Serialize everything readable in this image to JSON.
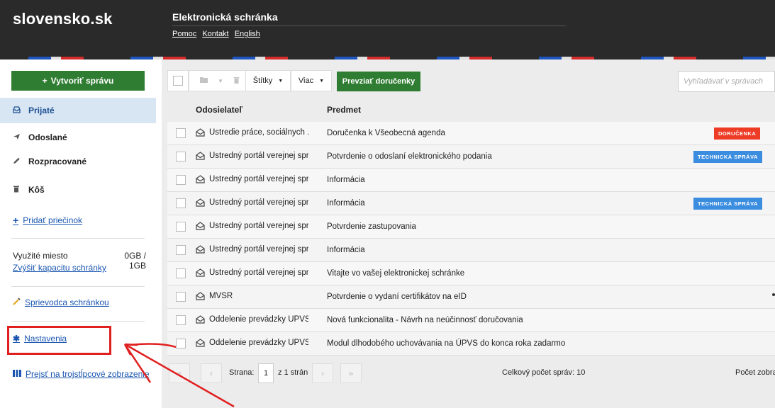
{
  "header": {
    "logo": "slovensko.sk",
    "app_title": "Elektronická schránka",
    "links": [
      "Pomoc",
      "Kontakt",
      "English"
    ]
  },
  "sidebar": {
    "create_button": "Vytvoriť správu",
    "nav": [
      "Prijaté",
      "Odoslané",
      "Rozpracované",
      "Kôš"
    ],
    "add_folder": "Pridať priečinok",
    "storage_label": "Využité miesto",
    "storage_value": "0GB / 1GB",
    "increase_capacity": "Zvýšiť kapacitu schránky",
    "guide": "Sprievodca schránkou",
    "settings": "Nastavenia",
    "three_column": "Prejsť na trojstĺpcové zobrazenie"
  },
  "toolbar": {
    "labels_button": "Štítky",
    "more_button": "Viac",
    "accept_button": "Prevziať doručenky",
    "search_placeholder": "Vyhľadávať v správach"
  },
  "table": {
    "columns": [
      "Odosielateľ",
      "Predmet"
    ],
    "rows": [
      {
        "sender": "Ústredie práce, sociálnych ...",
        "subject": "Doručenka k Všeobecná agenda",
        "tag": "DORUČENKA"
      },
      {
        "sender": "Ústredný portál verejnej spr...",
        "subject": "Potvrdenie o odoslaní elektronického podania",
        "tag": "TECHNICKÁ SPRÁVA"
      },
      {
        "sender": "Ústredný portál verejnej spr...",
        "subject": "Informácia",
        "tag": ""
      },
      {
        "sender": "Ústredný portál verejnej spr...",
        "subject": "Informácia",
        "tag": "TECHNICKÁ SPRÁVA"
      },
      {
        "sender": "Ústredný portál verejnej spr...",
        "subject": "Potvrdenie zastupovania",
        "tag": ""
      },
      {
        "sender": "Ústredný portál verejnej spr...",
        "subject": "Informácia",
        "tag": ""
      },
      {
        "sender": "Ústredný portál verejnej spr...",
        "subject": "Vitajte vo vašej elektronickej schránke",
        "tag": ""
      },
      {
        "sender": "MVSR",
        "subject": "Potvrdenie o vydaní certifikátov na eID",
        "tag": ""
      },
      {
        "sender": "Oddelenie prevádzky ÚPVS",
        "subject": "Nová funkcionalita - Návrh na neúčinnosť doručovania",
        "tag": ""
      },
      {
        "sender": "Oddelenie prevádzky ÚPVS",
        "subject": "Modul dlhodobého uchovávania na ÚPVS do konca roka zadarmo",
        "tag": ""
      }
    ]
  },
  "pager": {
    "page_label": "Strana:",
    "current_page": "1",
    "of_pages": "z 1 strán",
    "total_messages": "Celkový počet správ: 10",
    "display_count": "Počet zobra"
  },
  "colors": {
    "header_bg": "#2a2a2a",
    "green": "#2f7d32",
    "active_nav_bg": "#d8e6f4",
    "tag_red": "#ee3b26",
    "tag_blue": "#3b8de0",
    "annotation_red": "#e02020"
  }
}
